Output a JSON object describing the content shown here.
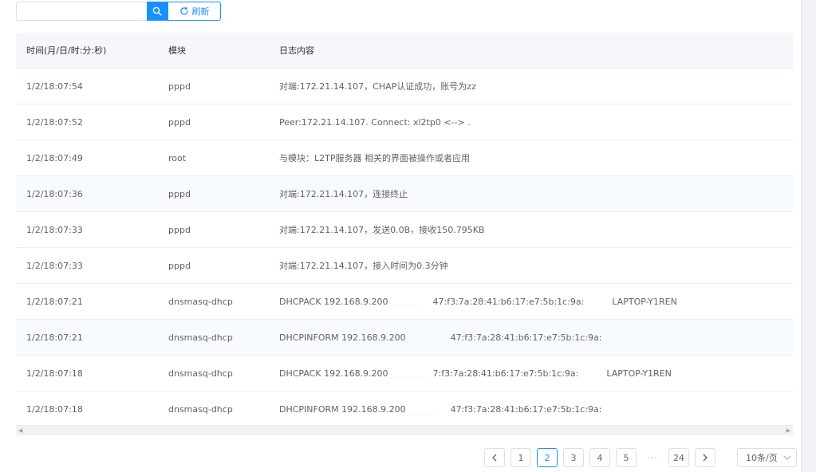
{
  "toolbar": {
    "search_value": "",
    "refresh_label": "刷新"
  },
  "table": {
    "headers": [
      "时间(月/日/时:分:秒)",
      "模块",
      "日志内容"
    ],
    "rows": [
      {
        "time": "1/2/18:07:54",
        "module": "pppd",
        "content": "对端:172.21.14.107，CHAP认证成功，账号为zz"
      },
      {
        "time": "1/2/18:07:52",
        "module": "pppd",
        "content": "Peer:172.21.14.107. Connect: xl2tp0 <--> ."
      },
      {
        "time": "1/2/18:07:49",
        "module": "root",
        "content": "与模块：L2TP服务器 相关的界面被操作或者应用"
      },
      {
        "time": "1/2/18:07:36",
        "module": "pppd",
        "content": "对端:172.21.14.107，连接终止"
      },
      {
        "time": "1/2/18:07:33",
        "module": "pppd",
        "content": "对端:172.21.14.107，发送0.0B，接收150.795KB"
      },
      {
        "time": "1/2/18:07:33",
        "module": "pppd",
        "content": "对端:172.21.14.107，接入时间为0.3分钟"
      },
      {
        "time": "1/2/18:07:21",
        "module": "dnsmasq-dhcp",
        "content": "DHCPACK 192.168.9.200                47:f3:7a:28:41:b6:17:e7:5b:1c:9a:          LAPTOP-Y1REN"
      },
      {
        "time": "1/2/18:07:21",
        "module": "dnsmasq-dhcp",
        "content": "DHCPINFORM 192.168.9.200                47:f3:7a:28:41:b6:17:e7:5b:1c:9a:"
      },
      {
        "time": "1/2/18:07:18",
        "module": "dnsmasq-dhcp",
        "content": "DHCPACK 192.168.9.200                7:f3:7a:28:41:b6:17:e7:5b:1c:9a:          LAPTOP-Y1REN"
      },
      {
        "time": "1/2/18:07:18",
        "module": "dnsmasq-dhcp",
        "content": "DHCPINFORM 192.168.9.200                47:f3:7a:28:41:b6:17:e7:5b:1c:9a:"
      }
    ]
  },
  "pagination": {
    "pages": [
      "1",
      "2",
      "3",
      "4",
      "5"
    ],
    "current": "2",
    "ellipsis": "···",
    "last": "24",
    "page_size": "10条/页"
  },
  "colors": {
    "accent": "#1890ff",
    "header_bg": "#f5f7fa",
    "border": "#ebeef5"
  },
  "icons": [
    "search-icon",
    "refresh-icon",
    "chevron-left-icon",
    "chevron-right-icon",
    "chevron-down-icon"
  ]
}
